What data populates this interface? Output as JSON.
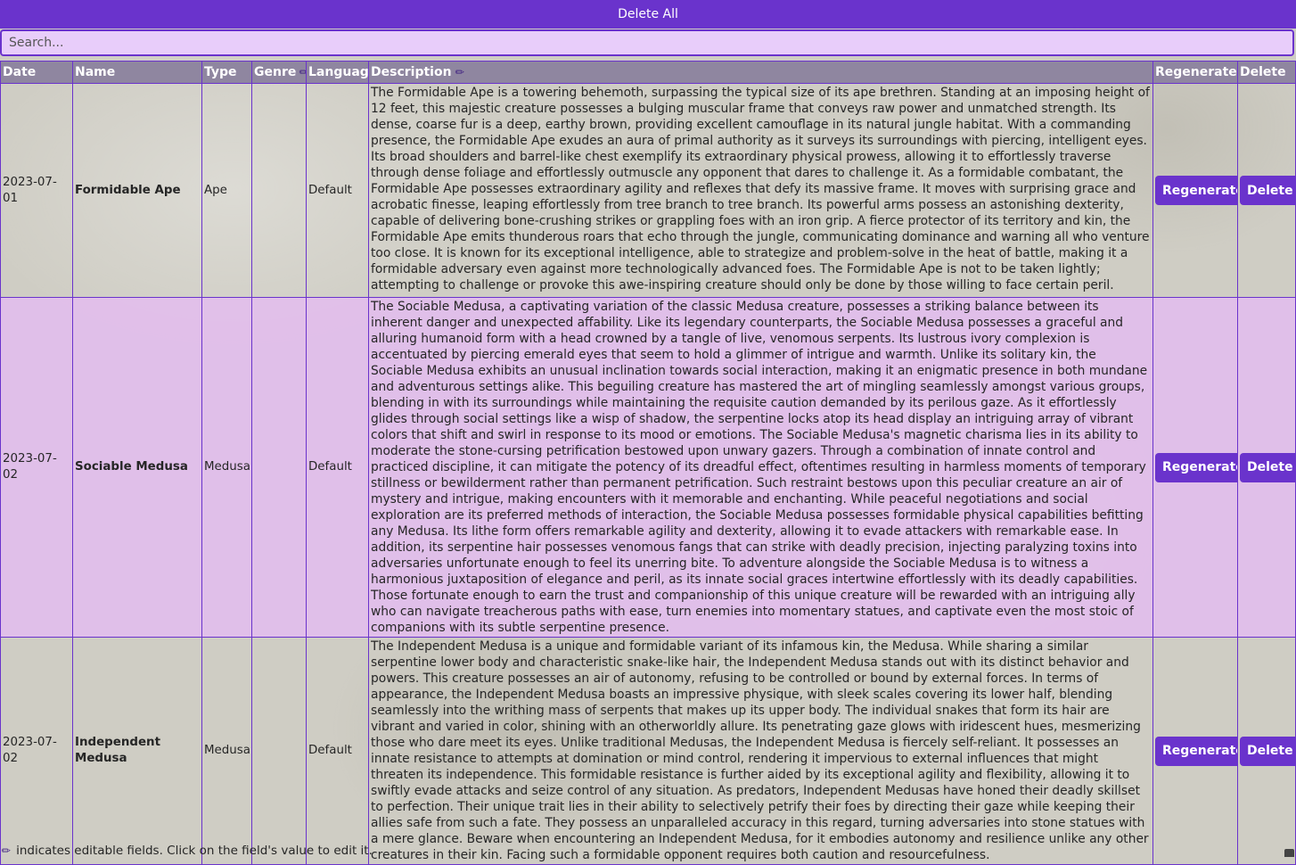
{
  "toolbar": {
    "delete_all_label": "Delete All"
  },
  "search": {
    "placeholder": "Search...",
    "value": ""
  },
  "table": {
    "columns": {
      "date": "Date",
      "name": "Name",
      "type": "Type",
      "genre": "Genre",
      "language": "Language",
      "description": "Description",
      "regenerate": "Regenerate",
      "delete": "Delete"
    },
    "editable_columns": [
      "genre",
      "description"
    ],
    "rows": [
      {
        "date": "2023-07-01",
        "name": "Formidable Ape",
        "type": "Ape",
        "genre": "",
        "language": "Default",
        "description": "The Formidable Ape is a towering behemoth, surpassing the typical size of its ape brethren. Standing at an imposing height of 12 feet, this majestic creature possesses a bulging muscular frame that conveys raw power and unmatched strength. Its dense, coarse fur is a deep, earthy brown, providing excellent camouflage in its natural jungle habitat. With a commanding presence, the Formidable Ape exudes an aura of primal authority as it surveys its surroundings with piercing, intelligent eyes. Its broad shoulders and barrel-like chest exemplify its extraordinary physical prowess, allowing it to effortlessly traverse through dense foliage and effortlessly outmuscle any opponent that dares to challenge it. As a formidable combatant, the Formidable Ape possesses extraordinary agility and reflexes that defy its massive frame. It moves with surprising grace and acrobatic finesse, leaping effortlessly from tree branch to tree branch. Its powerful arms possess an astonishing dexterity, capable of delivering bone-crushing strikes or grappling foes with an iron grip. A fierce protector of its territory and kin, the Formidable Ape emits thunderous roars that echo through the jungle, communicating dominance and warning all who venture too close. It is known for its exceptional intelligence, able to strategize and problem-solve in the heat of battle, making it a formidable adversary even against more technologically advanced foes. The Formidable Ape is not to be taken lightly; attempting to challenge or provoke this awe-inspiring creature should only be done by those willing to face certain peril.",
        "regenerate_label": "Regenerate",
        "delete_label": "Delete"
      },
      {
        "date": "2023-07-02",
        "name": "Sociable Medusa",
        "type": "Medusa",
        "genre": "",
        "language": "Default",
        "description": "The Sociable Medusa, a captivating variation of the classic Medusa creature, possesses a striking balance between its inherent danger and unexpected affability. Like its legendary counterparts, the Sociable Medusa possesses a graceful and alluring humanoid form with a head crowned by a tangle of live, venomous serpents. Its lustrous ivory complexion is accentuated by piercing emerald eyes that seem to hold a glimmer of intrigue and warmth. Unlike its solitary kin, the Sociable Medusa exhibits an unusual inclination towards social interaction, making it an enigmatic presence in both mundane and adventurous settings alike. This beguiling creature has mastered the art of mingling seamlessly amongst various groups, blending in with its surroundings while maintaining the requisite caution demanded by its perilous gaze. As it effortlessly glides through social settings like a wisp of shadow, the serpentine locks atop its head display an intriguing array of vibrant colors that shift and swirl in response to its mood or emotions. The Sociable Medusa's magnetic charisma lies in its ability to moderate the stone-cursing petrification bestowed upon unwary gazers. Through a combination of innate control and practiced discipline, it can mitigate the potency of its dreadful effect, oftentimes resulting in harmless moments of temporary stillness or bewilderment rather than permanent petrification. Such restraint bestows upon this peculiar creature an air of mystery and intrigue, making encounters with it memorable and enchanting. While peaceful negotiations and social exploration are its preferred methods of interaction, the Sociable Medusa possesses formidable physical capabilities befitting any Medusa. Its lithe form offers remarkable agility and dexterity, allowing it to evade attackers with remarkable ease. In addition, its serpentine hair possesses venomous fangs that can strike with deadly precision, injecting paralyzing toxins into adversaries unfortunate enough to feel its unerring bite. To adventure alongside the Sociable Medusa is to witness a harmonious juxtaposition of elegance and peril, as its innate social graces intertwine effortlessly with its deadly capabilities. Those fortunate enough to earn the trust and companionship of this unique creature will be rewarded with an intriguing ally who can navigate treacherous paths with ease, turn enemies into momentary statues, and captivate even the most stoic of companions with its subtle serpentine presence.",
        "regenerate_label": "Regenerate",
        "delete_label": "Delete"
      },
      {
        "date": "2023-07-02",
        "name": "Independent Medusa",
        "type": "Medusa",
        "genre": "",
        "language": "Default",
        "description": "The Independent Medusa is a unique and formidable variant of its infamous kin, the Medusa. While sharing a similar serpentine lower body and characteristic snake-like hair, the Independent Medusa stands out with its distinct behavior and powers. This creature possesses an air of autonomy, refusing to be controlled or bound by external forces. In terms of appearance, the Independent Medusa boasts an impressive physique, with sleek scales covering its lower half, blending seamlessly into the writhing mass of serpents that makes up its upper body. The individual snakes that form its hair are vibrant and varied in color, shining with an otherworldly allure. Its penetrating gaze glows with iridescent hues, mesmerizing those who dare meet its eyes. Unlike traditional Medusas, the Independent Medusa is fiercely self-reliant. It possesses an innate resistance to attempts at domination or mind control, rendering it impervious to external influences that might threaten its independence. This formidable resistance is further aided by its exceptional agility and flexibility, allowing it to swiftly evade attacks and seize control of any situation. As predators, Independent Medusas have honed their deadly skillset to perfection. Their unique trait lies in their ability to selectively petrify their foes by directing their gaze while keeping their allies safe from such a fate. They possess an unparalleled accuracy in this regard, turning adversaries into stone statues with a mere glance. Beware when encountering an Independent Medusa, for it embodies autonomy and resilience unlike any other creatures in their kin. Facing such a formidable opponent requires both caution and resourcefulness.",
        "regenerate_label": "Regenerate",
        "delete_label": "Delete"
      }
    ]
  },
  "footer": {
    "note": "indicates editable fields. Click on the field's value to edit it."
  },
  "icons": {
    "edit": "pencil-icon"
  },
  "colors": {
    "accent": "#6a33cc",
    "header_bg": "#8f86a0",
    "alt_row": "#e2beeb",
    "search_bg": "#e8cdfa"
  }
}
